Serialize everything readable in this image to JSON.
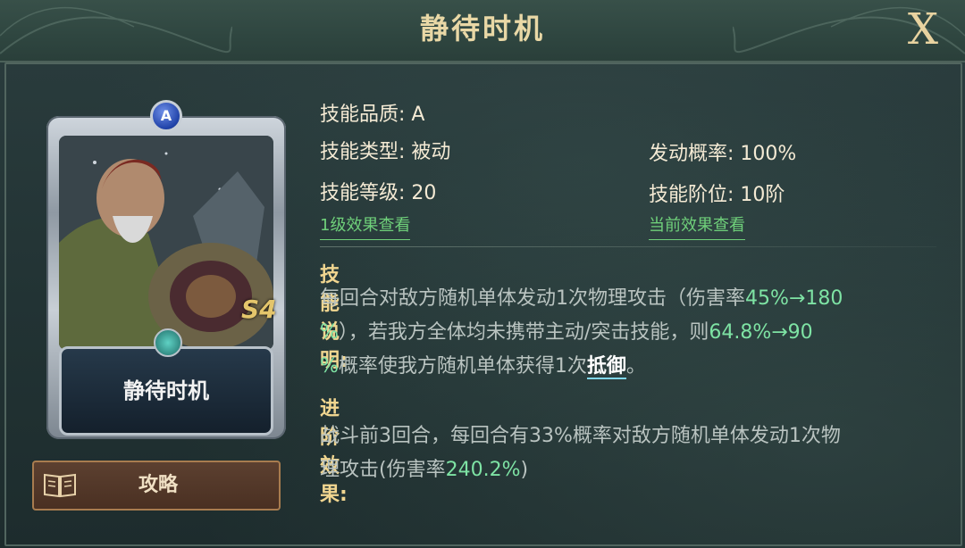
{
  "header": {
    "title": "静待时机",
    "close_label": "X"
  },
  "card": {
    "name": "静待时机",
    "rank_letter": "A",
    "badge": "S4"
  },
  "strategy_button": {
    "label": "攻略"
  },
  "attributes": {
    "quality": {
      "label": "技能品质: ",
      "value": "A"
    },
    "type": {
      "label": "技能类型: ",
      "value": "被动"
    },
    "level": {
      "label": "技能等级: ",
      "value": "20"
    },
    "trigger_rate": {
      "label": "发动概率: ",
      "value": "100%"
    },
    "tier": {
      "label": "技能阶位: ",
      "value": "10阶"
    }
  },
  "links": {
    "level1_effect": "1级效果查看",
    "current_effect": "当前效果查看"
  },
  "description": {
    "title": "技能说明:",
    "line1_a": "每回合对敌方随机单体发动1次物理攻击（伤害率",
    "line1_b": "45%→180",
    "line2_a": "%",
    "line2_b": "），若我方全体均未携带主动/突击技能，则",
    "line2_c": "64.8%→90",
    "line3_a": "%",
    "line3_b": "概率使我方随机单体获得1次",
    "keyword": "抵御",
    "line3_c": "。"
  },
  "advance": {
    "title": "进阶效果:",
    "line1": "战斗前3回合，每回合有33%概率对敌方随机单体发动1次物",
    "line2_a": "理攻击(伤害率",
    "line2_b": "240.2%",
    "line2_c": ")"
  }
}
